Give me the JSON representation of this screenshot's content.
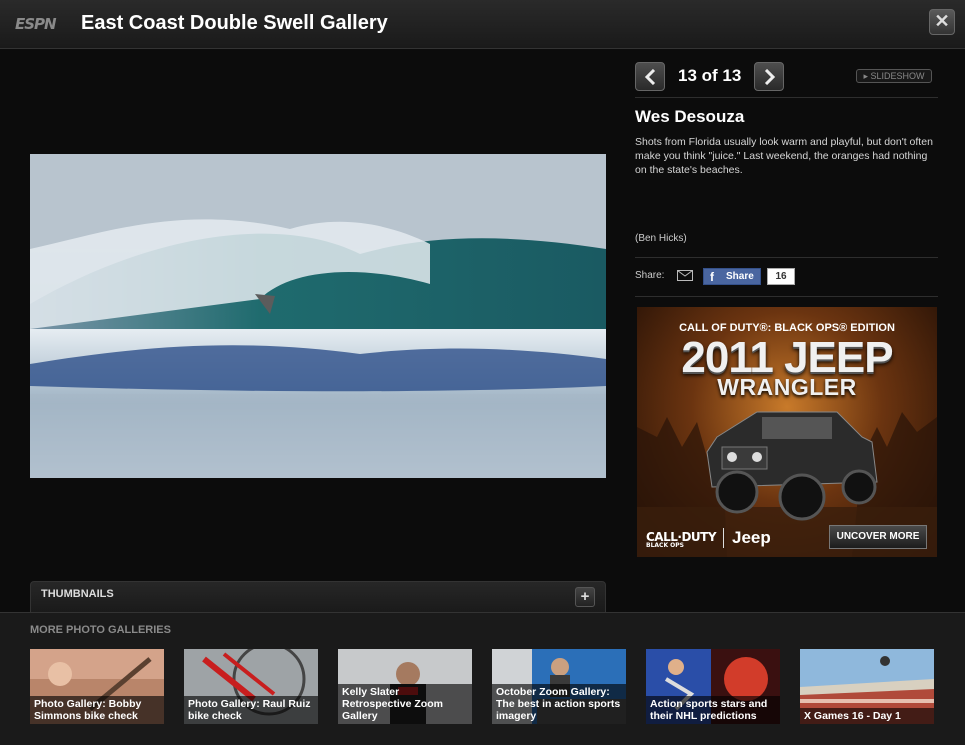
{
  "header": {
    "logo": "ESPN",
    "title": "East Coast Double Swell Gallery",
    "close_glyph": "✕"
  },
  "nav": {
    "counter": "13 of 13",
    "slideshow_label": "▸ SLIDESHOW",
    "prev_icon": "chevron-left-icon",
    "next_icon": "chevron-right-icon"
  },
  "photo": {
    "title": "Wes Desouza",
    "caption": "Shots from Florida usually look warm and playful, but don't often make you think \"juice.\" Last weekend, the oranges had nothing on the state's beaches.",
    "credit": "(Ben Hicks)"
  },
  "share": {
    "label": "Share:",
    "fb_icon": "f",
    "fb_label": "Share",
    "fb_count": "16"
  },
  "ad": {
    "tagline": "CALL OF DUTY®: BLACK OPS® EDITION",
    "year": "2011 JEEP",
    "model": "WRANGLER",
    "brand1": "CALL·DUTY",
    "brand1_sub": "BLACK OPS",
    "brand2": "Jeep",
    "cta": "UNCOVER MORE"
  },
  "thumbnails": {
    "label": "THUMBNAILS",
    "toggle": "+"
  },
  "more_galleries": {
    "title": "MORE PHOTO GALLERIES",
    "items": [
      {
        "caption": "Photo Gallery: Bobby Simmons bike check"
      },
      {
        "caption": "Photo Gallery: Raul Ruiz bike check"
      },
      {
        "caption": "Kelly Slater Retrospective Zoom Gallery"
      },
      {
        "caption": "October Zoom Gallery: The best in action sports imagery"
      },
      {
        "caption": "Action sports stars and their NHL predictions"
      },
      {
        "caption": "X Games 16 - Day 1"
      }
    ]
  },
  "colors": {
    "background": "#0c0c0c",
    "facebook": "#4a66a0",
    "wave_teal": "#1f6b6e"
  }
}
